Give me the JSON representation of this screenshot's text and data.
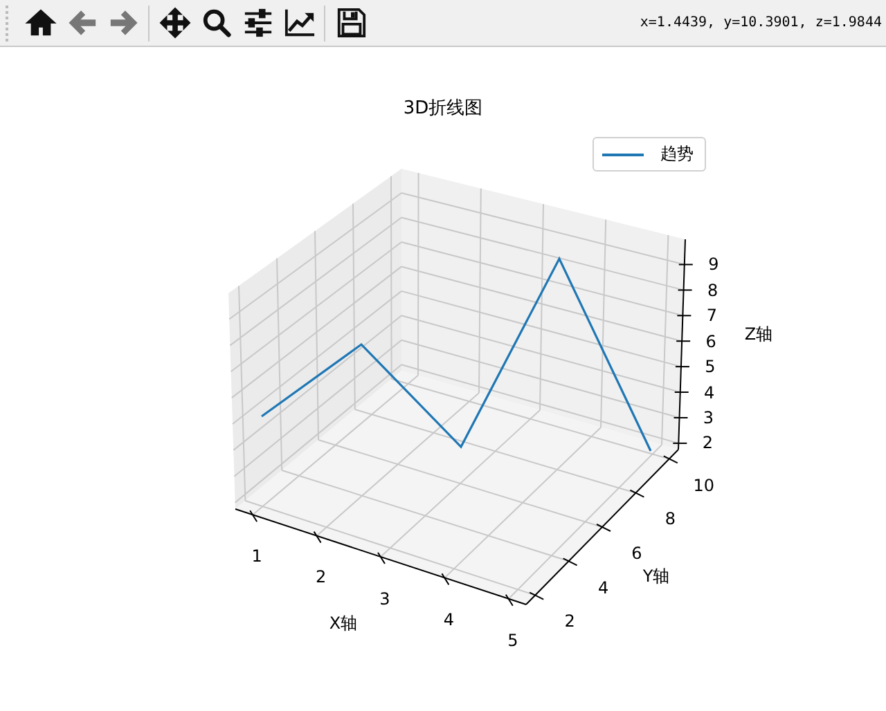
{
  "toolbar": {
    "buttons": [
      {
        "kind": "home",
        "disabled": false
      },
      {
        "kind": "back",
        "disabled": true
      },
      {
        "kind": "forward",
        "disabled": true
      },
      {
        "kind": "pan",
        "disabled": false
      },
      {
        "kind": "zoom",
        "disabled": false
      },
      {
        "kind": "configure",
        "disabled": false
      },
      {
        "kind": "edit-axes",
        "disabled": false
      },
      {
        "kind": "save",
        "disabled": false
      }
    ],
    "coordinates": "x=1.4439, y=10.3901, z=1.9844"
  },
  "plot": {
    "title": "3D折线图",
    "legend": [
      "趋势"
    ],
    "xlabel": "X轴",
    "ylabel": "Y轴",
    "zlabel": "Z轴",
    "xticks": [
      "1",
      "2",
      "3",
      "4",
      "5"
    ],
    "yticks": [
      "2",
      "4",
      "6",
      "8",
      "10"
    ],
    "zticks": [
      "9",
      "8",
      "7",
      "6",
      "5",
      "4",
      "3",
      "2"
    ]
  }
}
